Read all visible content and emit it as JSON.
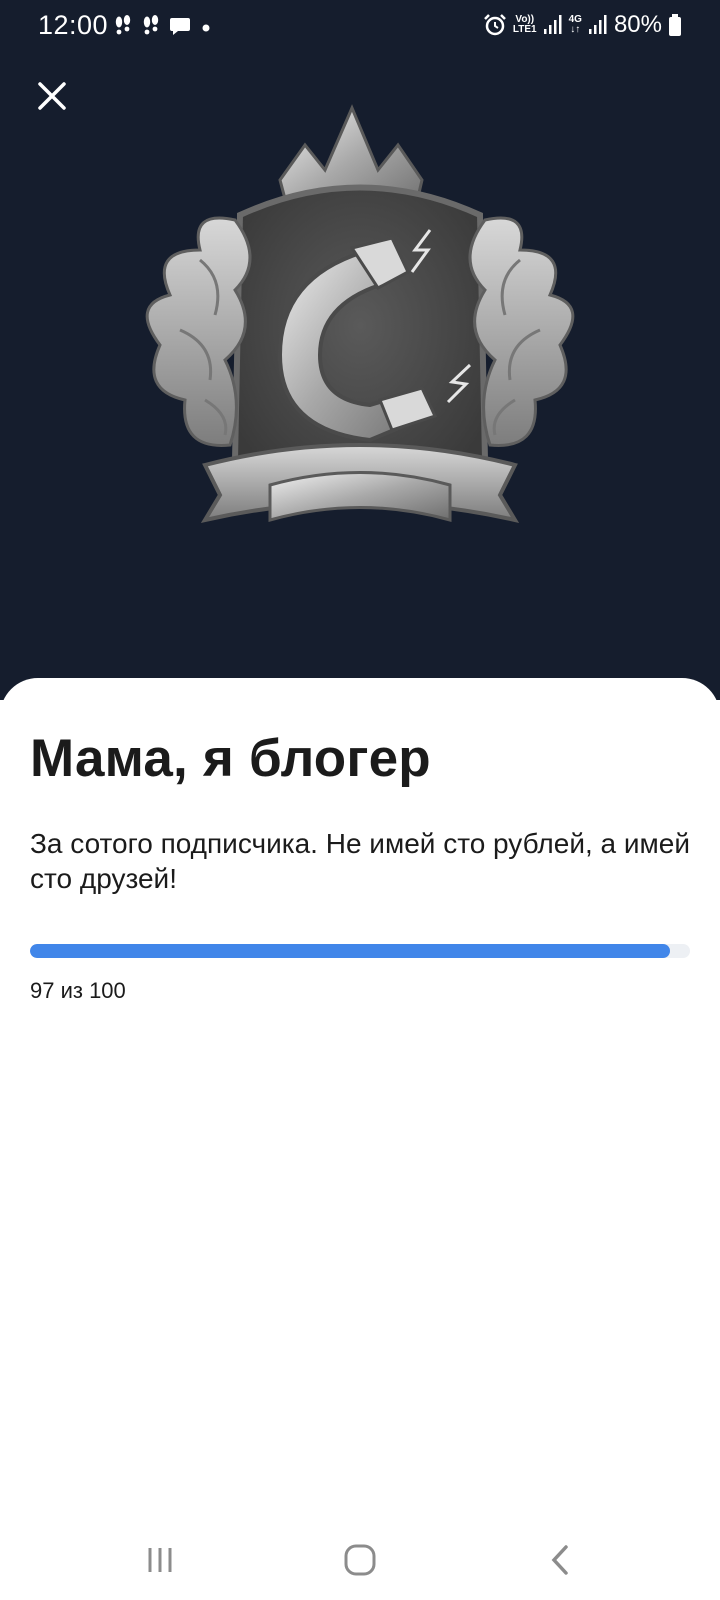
{
  "status_bar": {
    "time": "12:00",
    "battery_percent": "80%",
    "volte_label": "Vo))",
    "lte_label": "LTE1",
    "network_label": "4G",
    "icons": [
      "step-counter-icon",
      "step-counter-icon",
      "message-icon",
      "dot-icon",
      "alarm-icon",
      "signal-icon",
      "signal-icon",
      "battery-icon"
    ]
  },
  "header": {
    "close_icon": "close-icon"
  },
  "achievement": {
    "badge_icon": "magnet-crest-badge-icon",
    "title": "Мама, я блогер",
    "description": "За сотого подписчика. Не имей сто рублей, а имей сто друзей!",
    "progress": {
      "current": 97,
      "total": 100,
      "fraction": 0.97,
      "label": "97 из 100",
      "color": "#4186e9",
      "track_color": "#edf0f4"
    }
  },
  "nav_bar": {
    "icons": [
      "recent-apps-icon",
      "home-icon",
      "back-icon"
    ]
  },
  "colors": {
    "hero_background": "#151d2d",
    "sheet_background": "#ffffff",
    "text": "#1b1b1b"
  }
}
